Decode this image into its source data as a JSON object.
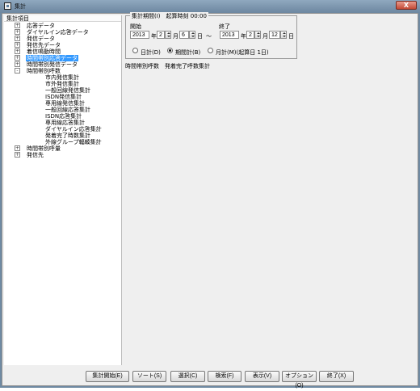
{
  "window": {
    "title": "集計",
    "close_label": "X"
  },
  "tree": {
    "header": "集計項目",
    "items": [
      {
        "expander": "+",
        "label": "応答データ"
      },
      {
        "expander": "+",
        "label": "ダイヤルイン応答データ"
      },
      {
        "expander": "+",
        "label": "発信データ"
      },
      {
        "expander": "+",
        "label": "発信先データ"
      },
      {
        "expander": "+",
        "label": "着信鳴動時間"
      },
      {
        "expander": "+",
        "label": "時間帯別応答データ"
      },
      {
        "expander": "+",
        "label": "時間帯別発信データ"
      },
      {
        "expander": "-",
        "label": "時間帯別呼数"
      },
      {
        "expander": "",
        "label": "市内発信集計"
      },
      {
        "expander": "",
        "label": "市外発信集計"
      },
      {
        "expander": "",
        "label": "一般回線発信集計"
      },
      {
        "expander": "",
        "label": "ISDN発信集計"
      },
      {
        "expander": "",
        "label": "専用線発信集計"
      },
      {
        "expander": "",
        "label": "一般回線応答集計"
      },
      {
        "expander": "",
        "label": "ISDN応答集計"
      },
      {
        "expander": "",
        "label": "専用線応答集計"
      },
      {
        "expander": "",
        "label": "ダイヤルイン応答集計"
      },
      {
        "expander": "",
        "label": "発着完了時数集計"
      },
      {
        "expander": "",
        "label": "外線グループ輻輳集計"
      },
      {
        "expander": "+",
        "label": "時間帯別呼量"
      },
      {
        "expander": "+",
        "label": "発信先"
      }
    ]
  },
  "period": {
    "legend": "集計期間(I)　起算時刻 00:00",
    "start_label": "開始",
    "end_label": "終了",
    "start_year": "2013",
    "year_label": "年",
    "start_month": "2",
    "month_label": "月",
    "start_day": "6",
    "day_label": "日",
    "range_symbol": "～",
    "end_year": "2013",
    "end_month": "2",
    "end_day": "12",
    "daily_label": "日計(D)",
    "period_total_label": "期間計(B)",
    "monthly_label": "月計(M)(起算日 1日)"
  },
  "main": {
    "selected_report": "時間帯別呼数　発着完了呼数集計"
  },
  "buttons": {
    "start": "集計開始(E)",
    "sort": "ソート(S)",
    "select": "選択(C)",
    "search": "検索(F)",
    "display": "表示(V)",
    "options": "オプション(O)",
    "exit": "終了(X)"
  }
}
